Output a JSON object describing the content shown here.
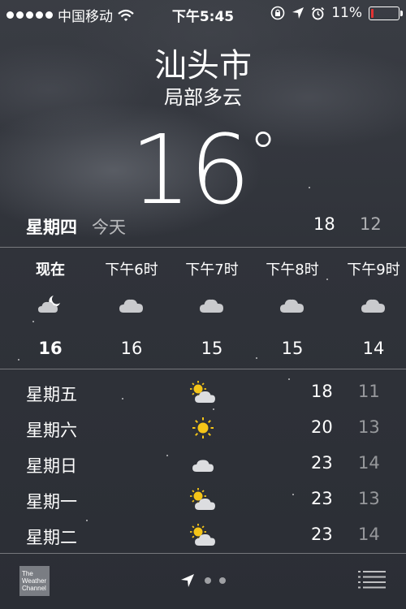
{
  "status": {
    "carrier": "中国移动",
    "time": "下午5:45",
    "battery_percent": "11%",
    "battery_level": 0.11,
    "battery_color": "#e33333",
    "icons": [
      "signal-dots",
      "wifi-icon",
      "orientation-lock-icon",
      "location-arrow-icon",
      "alarm-icon",
      "battery-icon"
    ]
  },
  "header": {
    "city": "汕头市",
    "condition": "局部多云",
    "temperature": "16",
    "degree_symbol": "°"
  },
  "today": {
    "day": "星期四",
    "label": "今天",
    "high": "18",
    "low": "12"
  },
  "hourly": [
    {
      "label": "现在",
      "icon": "moon-cloud-icon",
      "temp": "16"
    },
    {
      "label": "下午6时",
      "icon": "cloud-icon",
      "temp": "16"
    },
    {
      "label": "下午7时",
      "icon": "cloud-icon",
      "temp": "15"
    },
    {
      "label": "下午8时",
      "icon": "cloud-icon",
      "temp": "15"
    },
    {
      "label": "下午9时",
      "icon": "cloud-icon",
      "temp": "14"
    }
  ],
  "daily": [
    {
      "day": "星期五",
      "icon": "partly-sunny-icon",
      "high": "18",
      "low": "11"
    },
    {
      "day": "星期六",
      "icon": "sun-icon",
      "high": "20",
      "low": "13"
    },
    {
      "day": "星期日",
      "icon": "cloud-icon",
      "high": "23",
      "low": "14"
    },
    {
      "day": "星期一",
      "icon": "partly-sunny-icon",
      "high": "23",
      "low": "13"
    },
    {
      "day": "星期二",
      "icon": "partly-sunny-icon",
      "high": "23",
      "low": "14"
    }
  ],
  "footer": {
    "logo_text": "The Weather Channel",
    "page_count": 2,
    "current_page": 1,
    "icons": [
      "weather-channel-logo",
      "location-arrow-icon",
      "page-dot-icon",
      "list-menu-icon"
    ]
  }
}
